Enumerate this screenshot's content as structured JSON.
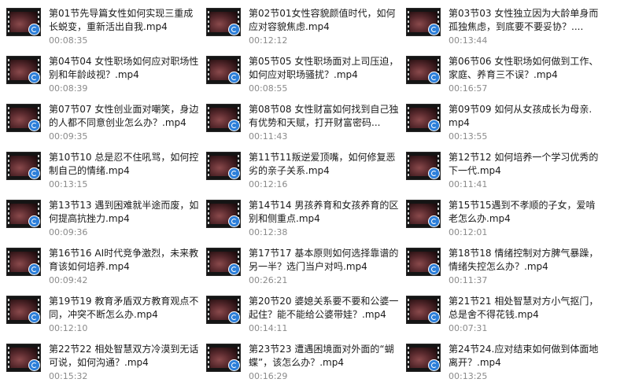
{
  "items": [
    {
      "title": "第01节先导篇女性如何实现三重成长蜕变，重新活出自我.mp4",
      "duration": "00:08:35"
    },
    {
      "title": "第02节01女性容貌颜值时代，如何应对容貌焦虑.mp4",
      "duration": "00:12:12"
    },
    {
      "title": "第03节03 女性独立因为大龄单身而孤独焦虑，到底要不要妥协？....",
      "duration": "00:13:44"
    },
    {
      "title": "第04节04 女性职场如何应对职场性别和年龄歧视？.mp4",
      "duration": "00:08:39"
    },
    {
      "title": "第05节05 女性职场面对上司压迫，如何应对职场骚扰？.mp4",
      "duration": "00:08:55"
    },
    {
      "title": "第06节06 女性职场如何做到工作、家庭、养育三不误？.mp4",
      "duration": "00:16:57"
    },
    {
      "title": "第07节07 女性创业面对嘲笑，身边的人都不同意创业怎么办？.mp4",
      "duration": "00:09:35"
    },
    {
      "title": "第08节08 女性财富如何找到自己独有优势和天赋，打开财富密码...",
      "duration": "00:11:43"
    },
    {
      "title": "第09节09 如何从女孩成长为母亲.mp4",
      "duration": "00:13:55"
    },
    {
      "title": "第10节10 总是忍不住吼骂，如何控制自己的情绪.mp4",
      "duration": "00:13:15"
    },
    {
      "title": "第11节11叛逆爱顶嘴，如何修复恶劣的亲子关系.mp4",
      "duration": "00:12:16"
    },
    {
      "title": "第12节12 如何培养一个学习优秀的下一代.mp4",
      "duration": "00:11:41"
    },
    {
      "title": "第13节13 遇到困难就半途而废，如何提高抗挫力.mp4",
      "duration": "00:09:36"
    },
    {
      "title": "第14节14 男孩养育和女孩养育的区别和侧重点.mp4",
      "duration": "00:12:38"
    },
    {
      "title": "第15节15遇到不孝顺的子女，爱啃老怎么办.mp4",
      "duration": "00:12:01"
    },
    {
      "title": "第16节16 AI时代竞争激烈，未来教育该如何培养.mp4",
      "duration": "00:09:42"
    },
    {
      "title": "第17节17 基本原则如何选择靠谱的另一半？选门当户对吗.mp4",
      "duration": "00:26:21"
    },
    {
      "title": "第18节18 情绪控制对方脾气暴躁，情绪失控怎么办？.mp4",
      "duration": "00:11:37"
    },
    {
      "title": "第19节19 教育矛盾双方教育观点不同，冲突不断怎么办.mp4",
      "duration": "00:12:10"
    },
    {
      "title": "第20节20 婆媳关系要不要和公婆一起住？能不能给公婆带娃？.mp4",
      "duration": "00:14:11"
    },
    {
      "title": "第21节21 相处智慧对方小气抠门，总是舍不得花钱.mp4",
      "duration": "00:07:31"
    },
    {
      "title": "第22节22 相处智慧双方冷漠到无话可说，如何沟通？.mp4",
      "duration": "00:15:32"
    },
    {
      "title": "第23节23 遭遇困境面对外面的“蝴蝶”，该怎么办？.mp4",
      "duration": "00:16:29"
    },
    {
      "title": "第24节24.应对结束如何做到体面地离开？.mp4",
      "duration": "00:13:25"
    }
  ]
}
